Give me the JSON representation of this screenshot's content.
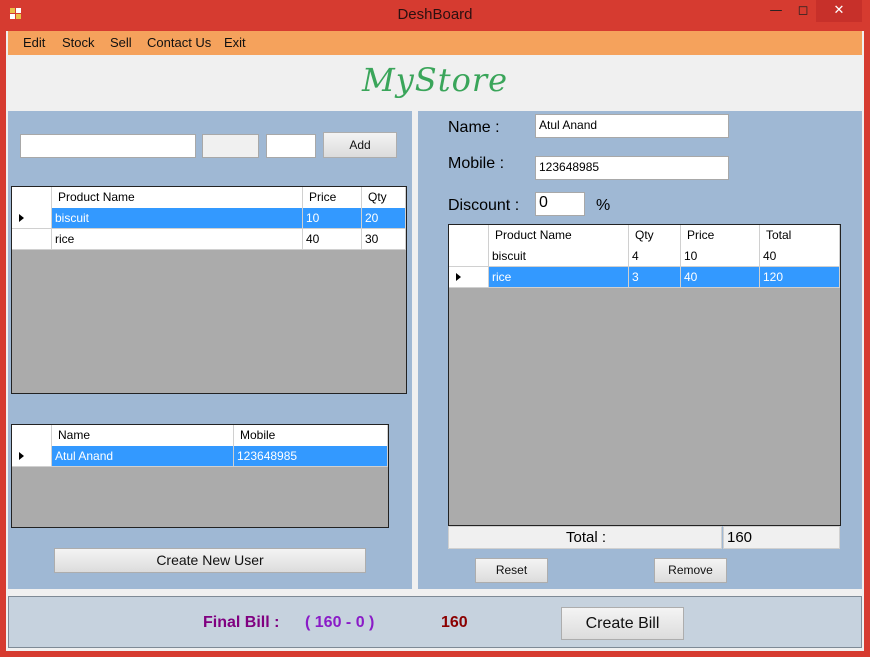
{
  "window": {
    "title": "DeshBoard"
  },
  "menu": {
    "items": [
      "Edit",
      "Stock",
      "Sell",
      "Contact Us",
      "Exit"
    ]
  },
  "brand": {
    "name": "MyStore"
  },
  "left": {
    "add_button": "Add",
    "stock_grid": {
      "headers": [
        "Product Name",
        "Price",
        "Qty"
      ],
      "rows": [
        {
          "name": "biscuit",
          "price": "10",
          "qty": "20"
        },
        {
          "name": "rice",
          "price": "40",
          "qty": "30"
        }
      ]
    },
    "user_grid": {
      "headers": [
        "Name",
        "Mobile"
      ],
      "rows": [
        {
          "name": "Atul Anand",
          "mobile": "123648985"
        }
      ]
    },
    "create_user_button": "Create New User"
  },
  "right": {
    "name_label": "Name :",
    "name_value": "Atul Anand",
    "mobile_label": "Mobile :",
    "mobile_value": "123648985",
    "discount_label": "Discount :",
    "discount_value": "0",
    "percent_sign": "%",
    "bill_grid": {
      "headers": [
        "Product Name",
        "Qty",
        "Price",
        "Total"
      ],
      "rows": [
        {
          "name": "biscuit",
          "qty": "4",
          "price": "10",
          "total": "40"
        },
        {
          "name": "rice",
          "qty": "3",
          "price": "40",
          "total": "120"
        }
      ]
    },
    "total_label": "Total :",
    "total_value": "160",
    "reset_button": "Reset",
    "remove_button": "Remove"
  },
  "bottom": {
    "final_bill_label": "Final Bill :",
    "formula": "( 160 - 0 )",
    "final_value": "160",
    "create_bill_button": "Create Bill"
  },
  "colors": {
    "titlebar": "#d63b30",
    "menubar": "#f5a25c",
    "brand": "#3aa55a",
    "panel": "#9fb8d4",
    "selection": "#3399ff",
    "final_label": "#800080",
    "final_value": "#8b0000"
  }
}
